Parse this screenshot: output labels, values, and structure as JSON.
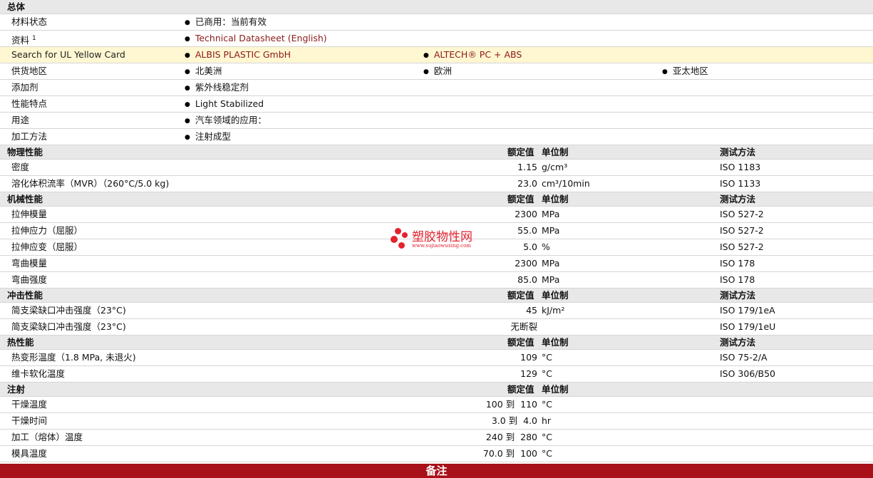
{
  "general": {
    "header": "总体",
    "material_status": {
      "label": "材料状态",
      "value": "已商用：当前有效"
    },
    "resources": {
      "label": "资料",
      "sup": "1",
      "value": "Technical Datasheet (English)"
    },
    "ul": {
      "label": "Search for UL Yellow Card",
      "v1": "ALBIS PLASTIC GmbH",
      "v2": "ALTECH® PC + ABS"
    },
    "supply": {
      "label": "供货地区",
      "v1": "北美洲",
      "v2": "欧洲",
      "v3": "亚太地区"
    },
    "additive": {
      "label": "添加剂",
      "value": "紫外线稳定剂"
    },
    "features": {
      "label": "性能特点",
      "value": "Light Stabilized"
    },
    "uses": {
      "label": "用途",
      "value": "汽车领域的应用："
    },
    "processing": {
      "label": "加工方法",
      "value": "注射成型"
    }
  },
  "col_headers": {
    "rated": "额定值",
    "unit": "单位制",
    "method": "测试方法"
  },
  "physical": {
    "header": "物理性能",
    "rows": [
      {
        "label": "密度",
        "value": "1.15",
        "unit": "g/cm³",
        "method": "ISO 1183"
      },
      {
        "label": "溶化体积流率（MVR）（260°C/5.0 kg)",
        "value": "23.0",
        "unit": "cm³/10min",
        "method": "ISO 1133"
      }
    ]
  },
  "mechanical": {
    "header": "机械性能",
    "rows": [
      {
        "label": "拉伸模量",
        "value": "2300",
        "unit": "MPa",
        "method": "ISO 527-2"
      },
      {
        "label": "拉伸应力（屈服）",
        "value": "55.0",
        "unit": "MPa",
        "method": "ISO 527-2"
      },
      {
        "label": "拉伸应变（屈服）",
        "value": "5.0",
        "unit": "%",
        "method": "ISO 527-2"
      },
      {
        "label": "弯曲模量",
        "value": "2300",
        "unit": "MPa",
        "method": "ISO 178"
      },
      {
        "label": "弯曲强度",
        "value": "85.0",
        "unit": "MPa",
        "method": "ISO 178"
      }
    ]
  },
  "impact": {
    "header": "冲击性能",
    "rows": [
      {
        "label": "简支梁缺口冲击强度（23°C)",
        "value": "45",
        "unit": "kJ/m²",
        "method": "ISO 179/1eA"
      },
      {
        "label": "简支梁缺口冲击强度（23°C)",
        "value": "无断裂",
        "unit": "",
        "method": "ISO 179/1eU"
      }
    ]
  },
  "thermal": {
    "header": "热性能",
    "rows": [
      {
        "label": "热变形温度（1.8 MPa, 未退火)",
        "value": "109",
        "unit": "°C",
        "method": "ISO 75-2/A"
      },
      {
        "label": "维卡软化温度",
        "value": "129",
        "unit": "°C",
        "method": "ISO 306/B50"
      }
    ]
  },
  "injection": {
    "header": "注射",
    "rows": [
      {
        "label": "干燥温度",
        "value": "100 到  110",
        "unit": "°C"
      },
      {
        "label": "干燥时间",
        "value": "3.0 到  4.0",
        "unit": "hr"
      },
      {
        "label": "加工（熔体）温度",
        "value": "240 到  280",
        "unit": "°C"
      },
      {
        "label": "模具温度",
        "value": "70.0 到  100",
        "unit": "°C"
      }
    ]
  },
  "footer": {
    "label": "备注"
  },
  "watermark": {
    "title": "塑胶物性网",
    "url": "www.sujiaowuxing.com"
  },
  "colors": {
    "link": "#8b1a1a",
    "footer": "#a8101a",
    "header_bg": "#e8e8e8",
    "highlight": "#fff7d2"
  }
}
